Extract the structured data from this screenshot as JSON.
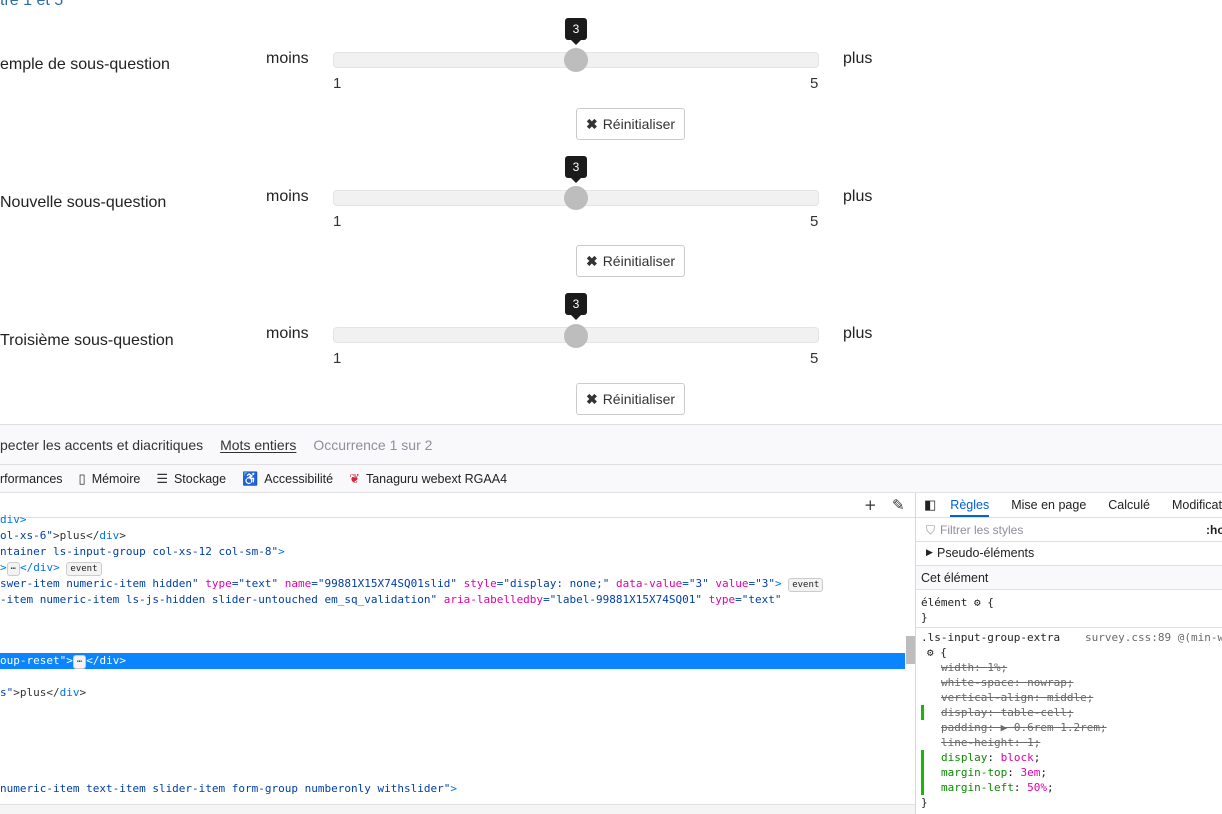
{
  "survey": {
    "top_text": "tre 1 et 5",
    "questions": [
      {
        "label": "emple de sous-question",
        "min_label": "moins",
        "max_label": "plus",
        "min": "1",
        "max": "5",
        "value": "3",
        "value_fraction": 0.5,
        "reset_label": "Réinitialiser"
      },
      {
        "label": " Nouvelle sous-question",
        "min_label": "moins",
        "max_label": "plus",
        "min": "1",
        "max": "5",
        "value": "3",
        "value_fraction": 0.5,
        "reset_label": "Réinitialiser"
      },
      {
        "label": "Troisième sous-question",
        "min_label": "moins",
        "max_label": "plus",
        "min": "1",
        "max": "5",
        "value": "3",
        "value_fraction": 0.5,
        "reset_label": "Réinitialiser"
      }
    ]
  },
  "find_bar": {
    "accents": "pecter les accents et diacritiques",
    "whole_words": "Mots entiers",
    "occurrence": "Occurrence 1 sur 2"
  },
  "devtools_tabs": [
    {
      "label": "rformances",
      "icon": "performance-icon"
    },
    {
      "label": "Mémoire",
      "icon": "memory-icon"
    },
    {
      "label": "Stockage",
      "icon": "storage-icon"
    },
    {
      "label": "Accessibilité",
      "icon": "accessibility-icon"
    },
    {
      "label": "Tanaguru webext RGAA4",
      "icon": "tanaguru-icon"
    }
  ],
  "html_lines": {
    "l1": "div>",
    "l2a": "ol-xs-6\"",
    "l2b": ">plus</",
    "l2c": "div",
    "l2d": ">",
    "l3a": "ntainer ls-input-group col-xs-12 col-sm-8\"",
    "l3b": ">",
    "l4a": ">",
    "l4b": "</",
    "l4c": "div",
    "l4d": ">",
    "badge_event": "event",
    "badge_dots": "⋯",
    "l5a": "swer-item numeric-item hidden\"",
    "l5b": " type",
    "l5c": "=\"text\"",
    "l5d": " name",
    "l5e": "=\"99881X15X74SQ01slid\"",
    "l5f": " style",
    "l5g": "=\"display: none;\"",
    "l5h": " data-value",
    "l5i": "=\"3\"",
    "l5j": " value",
    "l5k": "=\"3\"",
    "l5l": ">",
    "l6a": "-item numeric-item ls-js-hidden slider-untouched em_sq_validation\"",
    "l6b": " aria-labelledby",
    "l6c": "=\"label-99881X15X74SQ01\"",
    "l6d": " type",
    "l6e": "=\"text\"",
    "l7a": "oup-reset\"",
    "l7b": ">",
    "l7c": "</",
    "l7d": "div",
    "l7e": ">",
    "l8a": "s\"",
    "l8b": ">plus</",
    "l8c": "div",
    "l8d": ">",
    "l9a": "numeric-item text-item slider-item form-group numberonly withslider\"",
    "l9b": ">"
  },
  "rules": {
    "tabs": [
      "Règles",
      "Mise en page",
      "Calculé",
      "Modificatio"
    ],
    "filter_placeholder": "Filtrer les styles",
    "hov": ":ho",
    "pseudo": "Pseudo-éléments",
    "this_element": "Cet élément",
    "element_open": "élément ",
    "brace_open": " {",
    "brace_close": "}",
    "selector": ".ls-input-group-extra",
    "source": "survey.css:89 @(min-w",
    "decls": [
      {
        "prop": "width",
        "val": "1%",
        "strike": true
      },
      {
        "prop": "white-space",
        "val": "nowrap",
        "strike": true
      },
      {
        "prop": "vertical-align",
        "val": "middle",
        "strike": true
      },
      {
        "prop": "display",
        "val": "table-cell",
        "strike": true
      },
      {
        "prop": "padding",
        "val": "▶ 0.6rem 1.2rem",
        "strike": true
      },
      {
        "prop": "line-height",
        "val": "1",
        "strike": true
      },
      {
        "prop": "display",
        "val": "block",
        "strike": false
      },
      {
        "prop": "margin-top",
        "val": "3em",
        "strike": false
      },
      {
        "prop": "margin-left",
        "val": "50%",
        "strike": false
      }
    ]
  }
}
